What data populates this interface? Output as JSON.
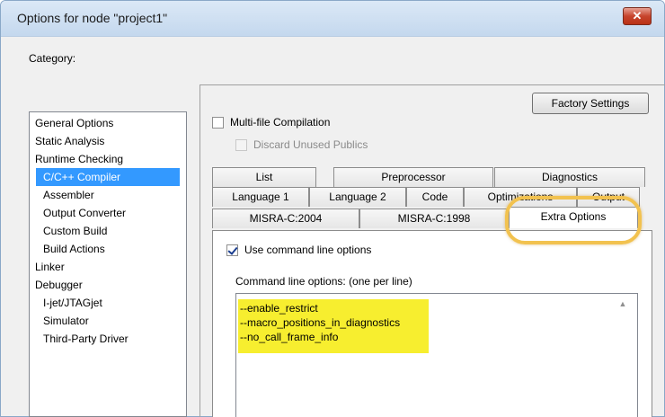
{
  "window": {
    "title": "Options for node \"project1\"",
    "close_glyph": "✕"
  },
  "category": {
    "label": "Category:",
    "items": [
      {
        "label": "General Options",
        "indent": false,
        "selected": false
      },
      {
        "label": "Static Analysis",
        "indent": false,
        "selected": false
      },
      {
        "label": "Runtime Checking",
        "indent": false,
        "selected": false
      },
      {
        "label": "C/C++ Compiler",
        "indent": true,
        "selected": true
      },
      {
        "label": "Assembler",
        "indent": true,
        "selected": false
      },
      {
        "label": "Output Converter",
        "indent": true,
        "selected": false
      },
      {
        "label": "Custom Build",
        "indent": true,
        "selected": false
      },
      {
        "label": "Build Actions",
        "indent": true,
        "selected": false
      },
      {
        "label": "Linker",
        "indent": false,
        "selected": false
      },
      {
        "label": "Debugger",
        "indent": false,
        "selected": false
      },
      {
        "label": "I-jet/JTAGjet",
        "indent": true,
        "selected": false
      },
      {
        "label": "Simulator",
        "indent": true,
        "selected": false
      },
      {
        "label": "Third-Party Driver",
        "indent": true,
        "selected": false
      }
    ],
    "selected_color": "#3399ff"
  },
  "factory_settings_label": "Factory Settings",
  "multifile": {
    "label": "Multi-file Compilation",
    "checked": false
  },
  "discard": {
    "label": "Discard Unused Publics",
    "checked": false,
    "disabled": true
  },
  "tabs": {
    "row1": [
      "List",
      "Preprocessor",
      "Diagnostics"
    ],
    "row2": [
      "Language 1",
      "Language 2",
      "Code",
      "Optimizations",
      "Output"
    ],
    "row3": [
      "MISRA-C:2004",
      "MISRA-C:1998",
      "Extra Options"
    ],
    "active": "Extra Options"
  },
  "use_cmdline": {
    "label": "Use command line options",
    "checked": true
  },
  "cmdline": {
    "label": "Command line options:  (one per line)",
    "lines": [
      "--enable_restrict",
      "--macro_positions_in_diagnostics",
      "--no_call_frame_info"
    ],
    "highlight_color": "#f7ee2f"
  },
  "callout_color": "#f2c24f"
}
